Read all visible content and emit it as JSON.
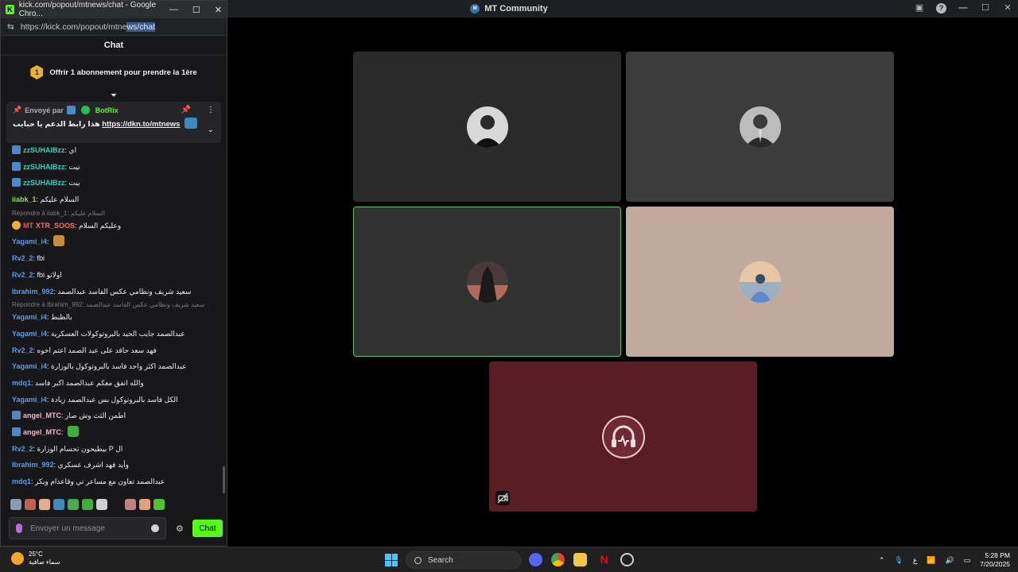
{
  "browser": {
    "window_title": "kick.com/popout/mtnews/chat - Google Chro...",
    "minimize": "—",
    "maximize": "☐",
    "close": "✕",
    "url_main": "https://kick.com/popout/mtne",
    "url_selected": "ws/chat"
  },
  "chat": {
    "header": "Chat",
    "sub_banner_count": "1",
    "sub_banner_text": "Offrir 1 abonnement pour prendre la 1ère",
    "pinned": {
      "sent_by": "Envoyé par",
      "bot_name": "BotRix",
      "message": "هذا رابط الدعم يا حبايب",
      "link": "https://dkn.to/mtnews"
    },
    "messages": [
      {
        "user": "zzSUHAIBzz",
        "color": "#2dd4bf",
        "badge": true,
        "text": "اي"
      },
      {
        "user": "zzSUHAIBzz",
        "color": "#2dd4bf",
        "badge": true,
        "text": "نيت"
      },
      {
        "user": "zzSUHAIBzz",
        "color": "#2dd4bf",
        "badge": true,
        "text": "بيت"
      },
      {
        "user": "iiabk_1",
        "color": "#8be04e",
        "badge": false,
        "text": "السلام عليكم"
      },
      {
        "reply": "Répondre à iiabk_1: السلام عليكم"
      },
      {
        "user": "XTR_SOOS",
        "color": "#ff6b6b",
        "badge": false,
        "prefix": "MT",
        "text": "وعليكم السلام"
      },
      {
        "user": "Yagami_i4",
        "color": "#5b9ae6",
        "badge": false,
        "text": "",
        "emote": "#c98b3a"
      },
      {
        "user": "Rv2_2",
        "color": "#5b9ae6",
        "badge": false,
        "text": "fbi"
      },
      {
        "user": "Rv2_2",
        "color": "#5b9ae6",
        "badge": false,
        "text": "fbi اولاتو"
      },
      {
        "user": "Ibrahim_992",
        "color": "#5b9ae6",
        "badge": false,
        "text": "سعيد شريف ونظامي عكس الفاسد عبدالصمد"
      },
      {
        "reply": "Répondre à Ibrahim_992: سعيد شريف ونظامي عكس الفاسد عبدالصمد"
      },
      {
        "user": "Yagami_i4",
        "color": "#5b9ae6",
        "badge": false,
        "text": "بالظبط"
      },
      {
        "user": "Yagami_i4",
        "color": "#5b9ae6",
        "badge": false,
        "text": "عبدالصمد جايب الحيد بالبروتوكولات العسكرية"
      },
      {
        "user": "Rv2_2",
        "color": "#5b9ae6",
        "badge": false,
        "text": "فهد سعد حاقد على عبد الصمد اعتم اخوه"
      },
      {
        "user": "Yagami_i4",
        "color": "#5b9ae6",
        "badge": false,
        "text": "عبدالصمد اكثر واحد فاسد بالبروتوكول بالوزارة"
      },
      {
        "user": "mdq1",
        "color": "#5b9ae6",
        "badge": false,
        "text": "والله اتفق معكم عبدالصمد اكبر فاسد"
      },
      {
        "user": "Yagami_i4",
        "color": "#5b9ae6",
        "badge": false,
        "text": "الكل فاسد بالبروتوكول بس عبدالصمد زيادة"
      },
      {
        "user": "angel_MTC",
        "color": "#f0b8c8",
        "badge": true,
        "text": "اطمن الثث وش صار"
      },
      {
        "user": "angel_MTC",
        "color": "#f0b8c8",
        "badge": true,
        "text": "",
        "emote": "#3fae3a"
      },
      {
        "user": "Rv2_2",
        "color": "#5b9ae6",
        "badge": false,
        "text": "بيطيحون تحسام الوزارة P ال"
      },
      {
        "user": "Ibrahim_992",
        "color": "#5b9ae6",
        "badge": false,
        "text": "وأيد فهد اشرف عسكري"
      },
      {
        "user": "mdq1",
        "color": "#5b9ae6",
        "badge": false,
        "text": "عبدالصمد تعاون مع مساعر تي وقاعدام ويكر"
      }
    ],
    "composer_placeholder": "Envoyer un message",
    "send_label": "Chat",
    "settings_icon": "⚙"
  },
  "stage": {
    "title": "MT Community",
    "server_icon_text": "M",
    "help": "?"
  },
  "taskbar": {
    "temperature": "25°C",
    "weather": "سماء صافية",
    "search_label": "Search",
    "lang": "ع",
    "time": "5:28 PM",
    "date": "7/20/2025"
  }
}
